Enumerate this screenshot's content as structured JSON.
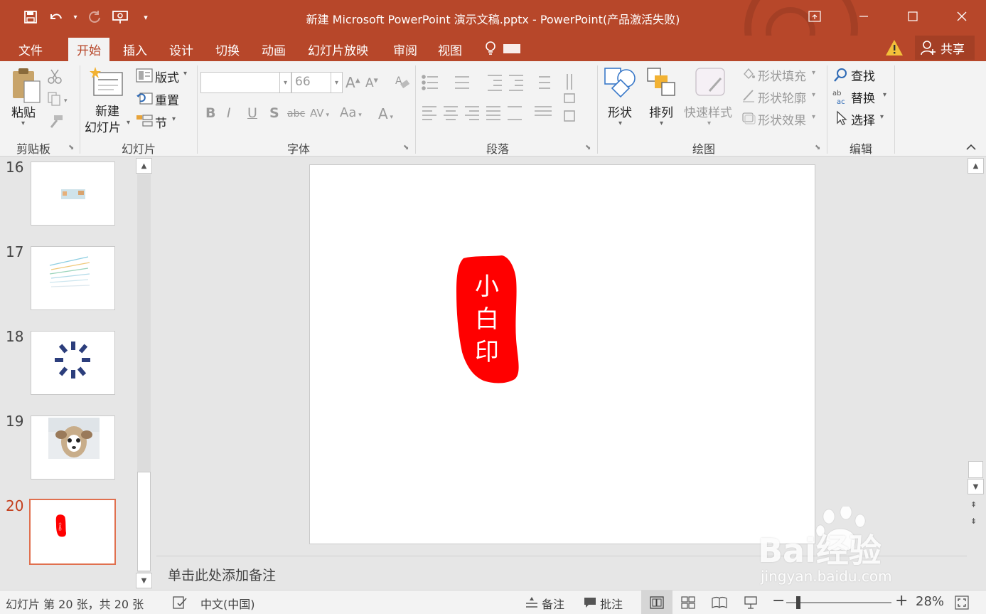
{
  "window": {
    "title": "新建 Microsoft PowerPoint 演示文稿.pptx - PowerPoint(产品激活失败)",
    "accent": "#b7472a"
  },
  "qat": {
    "icons": [
      "save-icon",
      "undo-icon",
      "redo-icon",
      "present-from-start-icon",
      "customize-qat-icon"
    ]
  },
  "tabs": [
    {
      "label": "文件"
    },
    {
      "label": "开始"
    },
    {
      "label": "插入"
    },
    {
      "label": "设计"
    },
    {
      "label": "切换"
    },
    {
      "label": "动画"
    },
    {
      "label": "幻灯片放映"
    },
    {
      "label": "审阅"
    },
    {
      "label": "视图"
    }
  ],
  "share": {
    "label": "共享"
  },
  "ribbon": {
    "clipboard": {
      "paste": "粘贴",
      "label": "剪贴板"
    },
    "slides": {
      "new_slide_1": "新建",
      "new_slide_2": "幻灯片",
      "layout": "版式",
      "reset": "重置",
      "section": "节",
      "label": "幻灯片"
    },
    "font": {
      "font_name": "",
      "font_size": "66",
      "label": "字体"
    },
    "paragraph": {
      "label": "段落"
    },
    "drawing": {
      "shapes": "形状",
      "arrange": "排列",
      "quick_styles": "快速样式",
      "fill": "形状填充",
      "outline": "形状轮廓",
      "effects": "形状效果",
      "label": "绘图"
    },
    "editing": {
      "find": "查找",
      "replace": "替换",
      "select": "选择",
      "label": "编辑"
    }
  },
  "slides": [
    {
      "number": "16"
    },
    {
      "number": "17"
    },
    {
      "number": "18"
    },
    {
      "number": "19"
    },
    {
      "number": "20",
      "selected": true
    }
  ],
  "slide": {
    "stamp_text": "小白印",
    "stamp_color": "#ff0000",
    "thumb_stamp_text": "小白印"
  },
  "notes": {
    "placeholder": "单击此处添加备注"
  },
  "status": {
    "slide_info": "幻灯片 第 20 张，共 20 张",
    "language": "中文(中国)",
    "notes_btn": "备注",
    "comments_btn": "批注",
    "zoom_out": "−",
    "zoom_in": "+",
    "zoom": "28%"
  },
  "watermark": {
    "brand": "Bai经验",
    "url": "jingyan.baidu.com"
  }
}
